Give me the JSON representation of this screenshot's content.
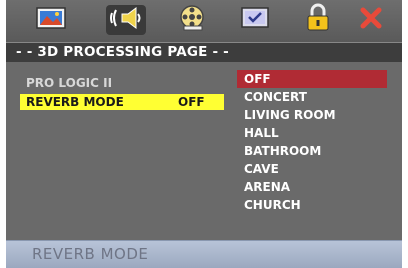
{
  "tabs": [
    {
      "icon": "picture-icon",
      "active": false
    },
    {
      "icon": "audio-speaker-icon",
      "active": true
    },
    {
      "icon": "film-reel-icon",
      "active": false
    },
    {
      "icon": "screen-check-icon",
      "active": false
    },
    {
      "icon": "lock-icon",
      "active": false
    },
    {
      "icon": "close-icon",
      "active": false
    }
  ],
  "page": {
    "title": "- - 3D PROCESSING PAGE - -"
  },
  "settings": [
    {
      "label": "PRO LOGIC II",
      "value": "",
      "selected": false
    },
    {
      "label": "REVERB MODE",
      "value": "OFF",
      "selected": true
    }
  ],
  "options": [
    {
      "label": "OFF",
      "selected": true
    },
    {
      "label": "CONCERT",
      "selected": false
    },
    {
      "label": "LIVING ROOM",
      "selected": false
    },
    {
      "label": "HALL",
      "selected": false
    },
    {
      "label": "BATHROOM",
      "selected": false
    },
    {
      "label": "CAVE",
      "selected": false
    },
    {
      "label": "ARENA",
      "selected": false
    },
    {
      "label": "CHURCH",
      "selected": false
    }
  ],
  "status": {
    "text": "REVERB MODE"
  },
  "colors": {
    "selection_highlight": "#ffff33",
    "option_highlight": "#b02b34",
    "close_x": "#e84a3a"
  }
}
